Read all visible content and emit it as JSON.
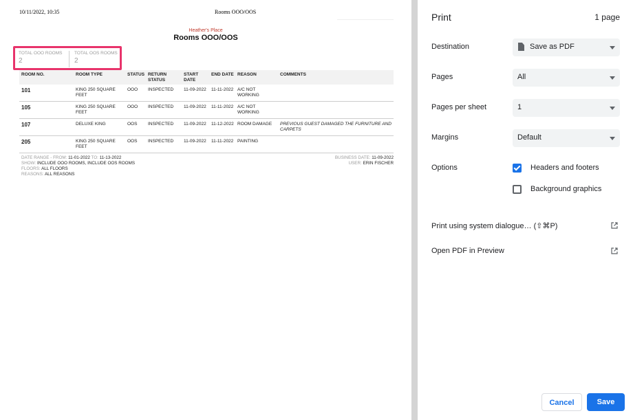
{
  "document": {
    "header_date": "10/11/2022, 10:35",
    "header_title": "Rooms OOO/OOS",
    "property_name": "Heather's Place",
    "report_title": "Rooms OOO/OOS",
    "totals": {
      "ooo_label": "TOTAL OOO ROOMS",
      "ooo_value": "2",
      "oos_label": "TOTAL OOS ROOMS",
      "oos_value": "2"
    },
    "columns": {
      "room_no": "ROOM NO.",
      "room_type": "ROOM TYPE",
      "status": "STATUS",
      "return_status": "RETURN STATUS",
      "start_date": "START DATE",
      "end_date": "END DATE",
      "reason": "REASON",
      "comments": "COMMENTS"
    },
    "rows": [
      {
        "room": "101",
        "type": "KING 250 SQUARE FEET",
        "status": "OOO",
        "return_status": "INSPECTED",
        "start": "11-09-2022",
        "end": "11-11-2022",
        "reason": "A/C NOT WORKING",
        "comments": ""
      },
      {
        "room": "105",
        "type": "KING 250 SQUARE FEET",
        "status": "OOO",
        "return_status": "INSPECTED",
        "start": "11-09-2022",
        "end": "11-11-2022",
        "reason": "A/C NOT WORKING",
        "comments": ""
      },
      {
        "room": "107",
        "type": "DELUXE KING",
        "status": "OOS",
        "return_status": "INSPECTED",
        "start": "11-09-2022",
        "end": "11-12-2022",
        "reason": "ROOM DAMAGE",
        "comments": "PREVIOUS GUEST DAMAGED THE FURNITURE AND CARPETS"
      },
      {
        "room": "205",
        "type": "KING 250 SQUARE FEET",
        "status": "OOS",
        "return_status": "INSPECTED",
        "start": "11-09-2022",
        "end": "11-11-2022",
        "reason": "PAINTING",
        "comments": ""
      }
    ],
    "footer": {
      "date_range_label": "DATE RANGE - FROM:",
      "date_from": "11-01-2022",
      "to_label": "TO:",
      "date_to": "11-13-2022",
      "show_label": "SHOW:",
      "show_value": "INCLUDE OOO ROOMS, INCLUDE OOS ROOMS",
      "floors_label": "FLOORS:",
      "floors_value": "ALL FLOORS",
      "reasons_label": "REASONS:",
      "reasons_value": "ALL REASONS",
      "business_date_label": "BUSINESS DATE:",
      "business_date": "11-09-2022",
      "user_label": "USER:",
      "user": "ERIN FISCHER"
    }
  },
  "print_panel": {
    "title": "Print",
    "page_count": "1 page",
    "destination_label": "Destination",
    "destination_value": "Save as PDF",
    "pages_label": "Pages",
    "pages_value": "All",
    "pages_per_sheet_label": "Pages per sheet",
    "pages_per_sheet_value": "1",
    "margins_label": "Margins",
    "margins_value": "Default",
    "options_label": "Options",
    "headers_footers_label": "Headers and footers",
    "headers_footers_checked": true,
    "background_graphics_label": "Background graphics",
    "background_graphics_checked": false,
    "system_dialogue_label": "Print using system dialogue… (⇧⌘P)",
    "open_pdf_label": "Open PDF in Preview",
    "cancel_label": "Cancel",
    "save_label": "Save"
  },
  "colors": {
    "accent": "#1a73e8",
    "highlight": "#e8336b",
    "property_red": "#c0392b"
  }
}
